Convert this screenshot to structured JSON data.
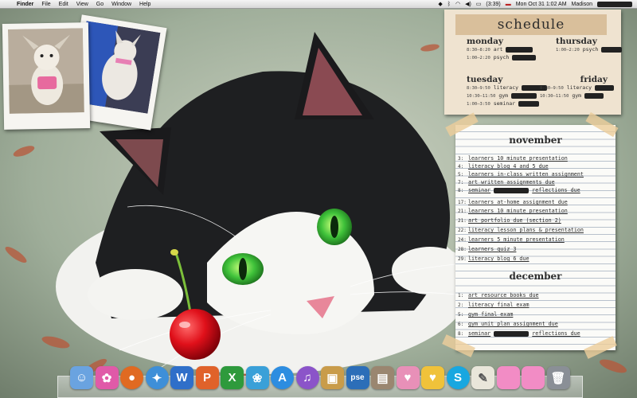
{
  "menubar": {
    "apple_glyph": "",
    "items": [
      "Finder",
      "File",
      "Edit",
      "View",
      "Go",
      "Window",
      "Help"
    ],
    "battery": "(3:39)",
    "clock": "Mon Oct 31  1:02 AM",
    "user": "Madison"
  },
  "schedule": {
    "title": "schedule",
    "monday": {
      "label": "monday",
      "rows": [
        {
          "time": "8:30–8:20",
          "name": "art"
        },
        {
          "time": "1:00–2:20",
          "name": "psych"
        }
      ]
    },
    "thursday": {
      "label": "thursday",
      "rows": [
        {
          "time": "1:00–2:20",
          "name": "psych"
        }
      ]
    },
    "tuesday": {
      "label": "tuesday",
      "rows": [
        {
          "time": "8:30–9:50",
          "name": "literacy"
        },
        {
          "time": "10:30–11:50",
          "name": "gym"
        },
        {
          "time": "1:00–3:50",
          "name": "seminar"
        }
      ]
    },
    "friday": {
      "label": "friday",
      "rows": [
        {
          "time": "8:30–9:50",
          "name": "literacy"
        },
        {
          "time": "10:30–11:50",
          "name": "gym"
        }
      ]
    }
  },
  "agenda": {
    "november": {
      "label": "november",
      "entries": [
        {
          "day": "3:",
          "text": "learners 10 minute presentation"
        },
        {
          "day": "4:",
          "text": "literacy blog 4 and 5 due"
        },
        {
          "day": "5:",
          "text": "learners in-class written assignment"
        },
        {
          "day": "7:",
          "text": "art written assignments due"
        },
        {
          "day": "8:",
          "text": "seminar",
          "text2": "reflections due"
        },
        {
          "day": "17:",
          "text": "learners at-home assignment due"
        },
        {
          "day": "21:",
          "text": "learners 10 minute presentation"
        },
        {
          "day": "21:",
          "text": "art portfolio due (section 2)"
        },
        {
          "day": "22:",
          "text": "literacy lesson plans & presentation"
        },
        {
          "day": "24:",
          "text": "learners 5 minute presentation"
        },
        {
          "day": "28:",
          "text": "learners quiz 3"
        },
        {
          "day": "29:",
          "text": "literacy blog 6 due"
        }
      ]
    },
    "december": {
      "label": "december",
      "entries": [
        {
          "day": "1:",
          "text": "art resource books due"
        },
        {
          "day": "2:",
          "text": "literacy final exam"
        },
        {
          "day": "5:",
          "text": "gym final exam"
        },
        {
          "day": "6:",
          "text": "gym unit plan assignment due"
        },
        {
          "day": "8:",
          "text": "seminar",
          "text2": "reflections due"
        }
      ]
    }
  },
  "dock": {
    "icons": [
      {
        "name": "finder-icon",
        "glyph": "☺",
        "color": "#6aa3e0"
      },
      {
        "name": "app-pink-swirl-icon",
        "glyph": "✿",
        "color": "#e05aa8"
      },
      {
        "name": "firefox-icon",
        "glyph": "●",
        "color": "#e06a22"
      },
      {
        "name": "safari-icon",
        "glyph": "✦",
        "color": "#3e8fd8"
      },
      {
        "name": "word-icon",
        "glyph": "W",
        "color": "#2f6fc9"
      },
      {
        "name": "powerpoint-icon",
        "glyph": "P",
        "color": "#e0622a"
      },
      {
        "name": "excel-icon",
        "glyph": "X",
        "color": "#2e9a3c"
      },
      {
        "name": "messenger-icon",
        "glyph": "❀",
        "color": "#3aa0d8"
      },
      {
        "name": "app-store-icon",
        "glyph": "A",
        "color": "#2d8de0"
      },
      {
        "name": "itunes-icon",
        "glyph": "♫",
        "color": "#8b54c9"
      },
      {
        "name": "preview-icon",
        "glyph": "▣",
        "color": "#c99c4a"
      },
      {
        "name": "photoshop-elements-icon",
        "glyph": "pse",
        "color": "#2c6eb8"
      },
      {
        "name": "photo-app-icon",
        "glyph": "▤",
        "color": "#9a8670"
      },
      {
        "name": "cupcake-icon",
        "glyph": "♥",
        "color": "#e890b8"
      },
      {
        "name": "heart-badge-icon",
        "glyph": "♥",
        "color": "#f0c23a"
      },
      {
        "name": "skype-icon",
        "glyph": "S",
        "color": "#18a7e0"
      },
      {
        "name": "textedit-icon",
        "glyph": "✎",
        "color": "#e9e6da"
      },
      {
        "name": "pink-folder-icon",
        "glyph": "",
        "color": "#f28cc5"
      },
      {
        "name": "pink-folder-2-icon",
        "glyph": "",
        "color": "#f28cc5"
      },
      {
        "name": "trash-icon",
        "glyph": "🗑",
        "color": "#8a8f96"
      }
    ]
  }
}
